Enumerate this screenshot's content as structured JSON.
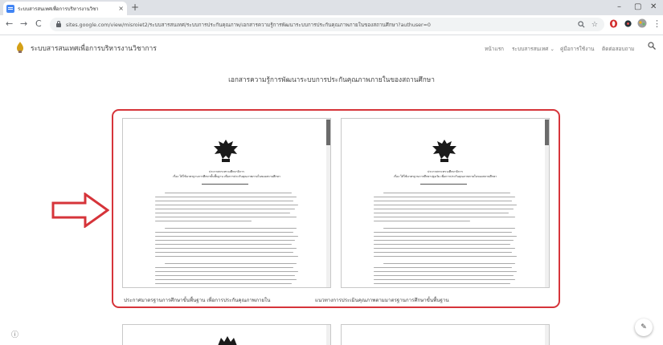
{
  "browser": {
    "tab_title": "ระบบสารสนเทศเพื่อการบริหารงานวิชา",
    "tab_close": "×",
    "new_tab": "+",
    "minimize": "–",
    "maximize": "▢",
    "close": "✕",
    "back": "←",
    "forward": "→",
    "reload": "C",
    "url": "sites.google.com/view/misroiet2/ระบบสารสนเทศ/ระบบการประกันคุณภาพ/เอกสารความรู้การพัฒนาระบบการประกันคุณภาพภายในของสถานศึกษา?authuser=0",
    "zoom_icon": "search-icon",
    "star": "☆",
    "menu": "⋮"
  },
  "site": {
    "title": "ระบบสารสนเทศเพื่อการบริหารงานวิชาการ",
    "nav": [
      "หน้าแรก",
      "ระบบสารสนเทศ ⌄",
      "คู่มือการใช้งาน",
      "ติดต่อสอบถาม"
    ],
    "search": "⚲"
  },
  "main": {
    "heading": "เอกสารความรู้การพัฒนาระบบการประกันคุณภาพภายในของสถานศึกษา",
    "documents": [
      {
        "caption": "ประกาศมาตรฐานการศึกษาขั้นพื้นฐาน เพื่อการประกันคุณภาพภายใน",
        "header": "ประกาศกระทรวงศึกษาธิการ",
        "subheader": "เรื่อง ให้ใช้มาตรฐานการศึกษาขั้นพื้นฐาน เพื่อการประกันคุณภาพภายในของสถานศึกษา"
      },
      {
        "caption": "แนวทางการประเมินคุณภาพตามมาตรฐานการศึกษาขั้นพื้นฐาน",
        "header": "ประกาศกระทรวงศึกษาธิการ",
        "subheader": "เรื่อง ให้ใช้มาตรฐานการศึกษาปฐมวัย เพื่อการประกันคุณภาพภายในของสถานศึกษา"
      }
    ]
  },
  "colors": {
    "highlight": "#d6343a",
    "tab_favicon": "#4285f4"
  },
  "footer": {
    "info_icon": "ⓘ",
    "edit_icon": "✎"
  }
}
